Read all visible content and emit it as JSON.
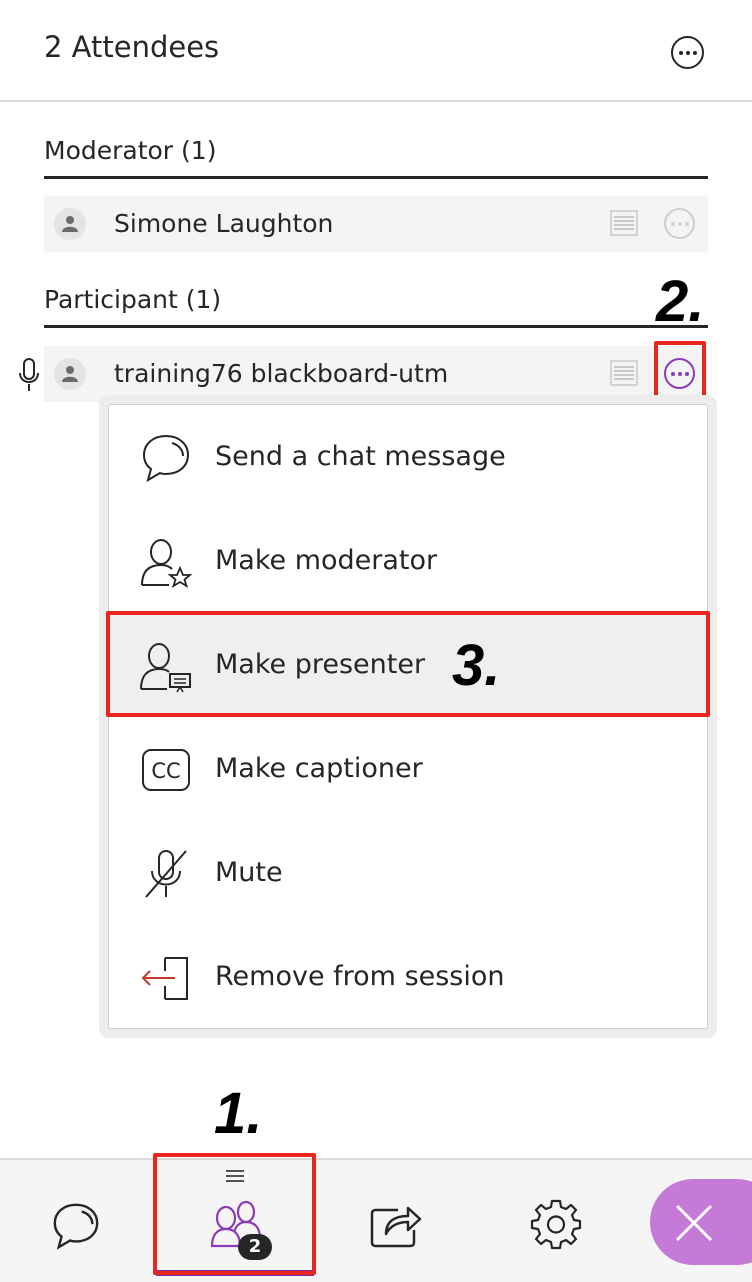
{
  "header": {
    "title": "2 Attendees"
  },
  "sections": {
    "moderator": {
      "title": "Moderator (1)",
      "name": "Simone Laughton"
    },
    "participant": {
      "title": "Participant (1)",
      "name": "training76 blackboard-utm"
    }
  },
  "menu": {
    "items": [
      {
        "label": "Send a chat message",
        "icon": "chat-bubble-icon"
      },
      {
        "label": "Make moderator",
        "icon": "person-star-icon"
      },
      {
        "label": "Make presenter",
        "icon": "person-presentation-icon"
      },
      {
        "label": "Make captioner",
        "icon": "cc-icon"
      },
      {
        "label": "Mute",
        "icon": "mic-muted-icon"
      },
      {
        "label": "Remove from session",
        "icon": "exit-door-icon"
      }
    ]
  },
  "bottom_bar": {
    "attendees_count": "2",
    "tabs": [
      "chat-tab",
      "attendees-tab",
      "share-content-tab",
      "settings-tab"
    ]
  },
  "annotations": {
    "step1": "1.",
    "step2": "2.",
    "step3": "3."
  },
  "colors": {
    "accent": "#7a2fa7",
    "annotation_red": "#e8261d",
    "close_button": "#c47ad6",
    "text": "#262626"
  }
}
